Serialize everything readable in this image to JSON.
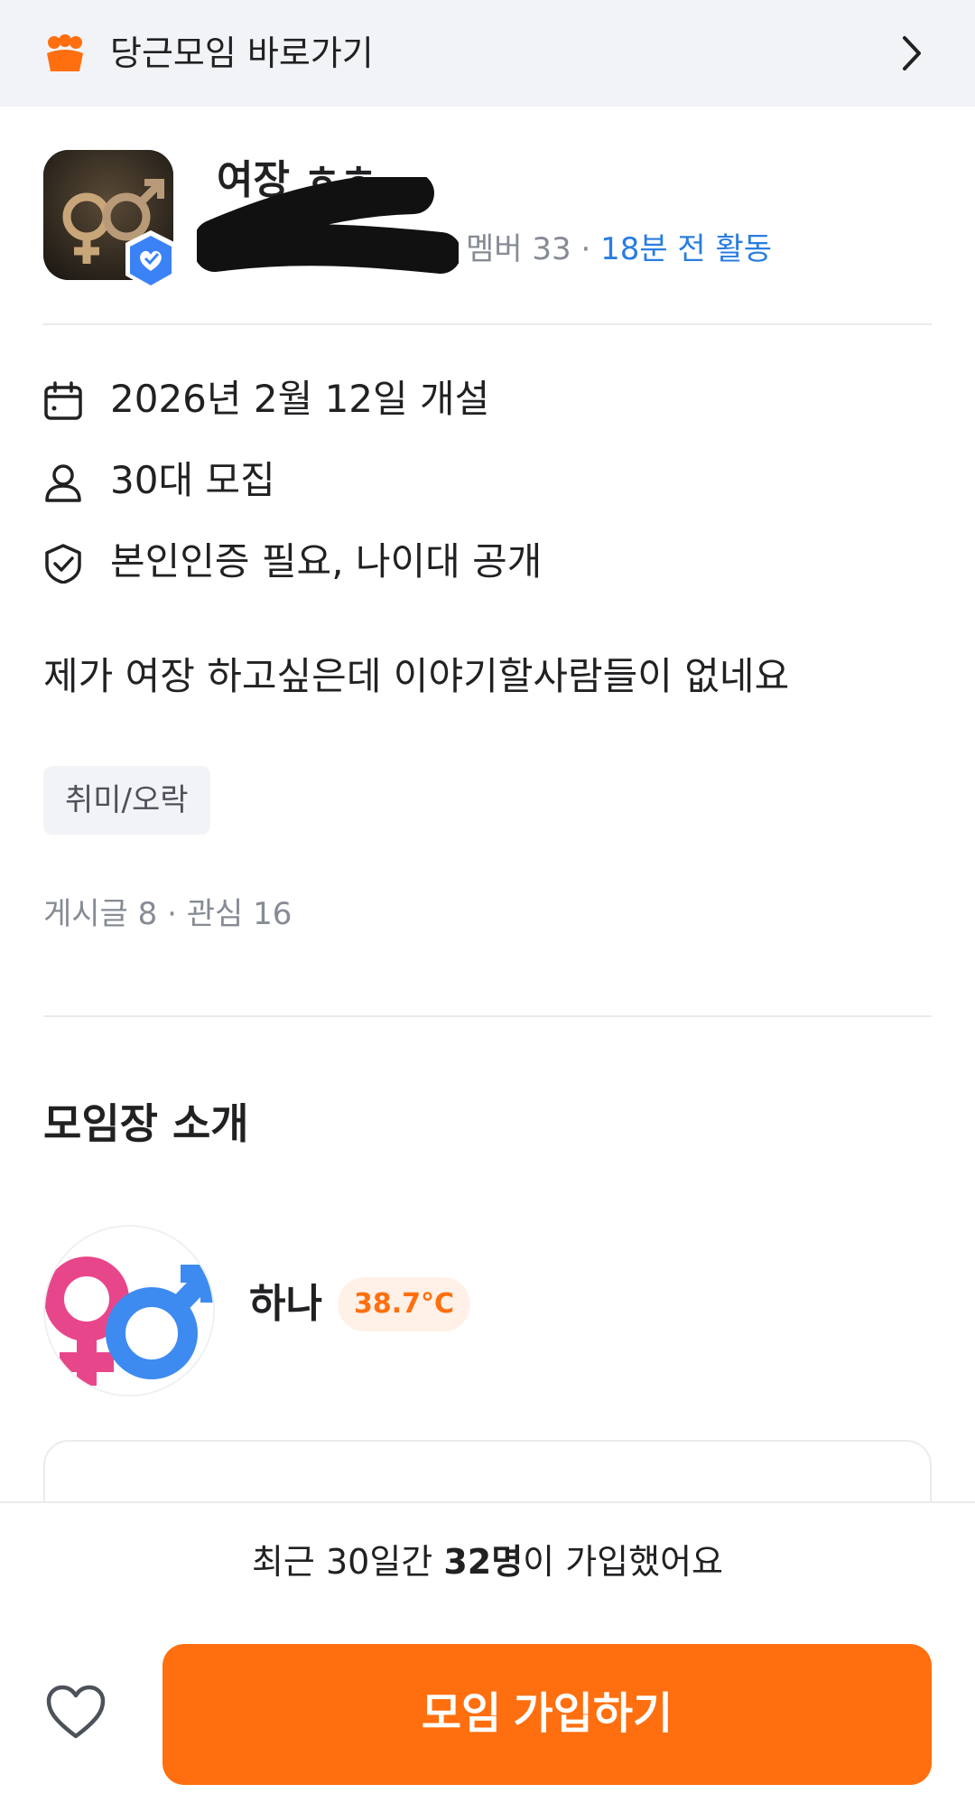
{
  "topbar": {
    "label": "당근모임 바로가기"
  },
  "group": {
    "title": "여장 ㅎㅎ",
    "members": "멤버 33",
    "separator": " · ",
    "activity": "18분 전 활동"
  },
  "info": {
    "opened": "2026년 2월 12일 개설",
    "recruit": "30대 모집",
    "requirements": "본인인증 필요, 나이대 공개"
  },
  "description": "제가 여장 하고싶은데 이야기할사람들이 없네요",
  "tag": "취미/오락",
  "stats": "게시글 8 · 관심 16",
  "leader_section": {
    "title": "모임장 소개",
    "name": "하나",
    "temperature": "38.7°C"
  },
  "bottom": {
    "note_prefix": "최근 30일간 ",
    "note_bold": "32명",
    "note_suffix": "이 가입했어요",
    "join_label": "모임 가입하기"
  },
  "colors": {
    "accent": "#ff6f0f",
    "activity": "#2a7de1",
    "badge": "#3b82f6"
  }
}
